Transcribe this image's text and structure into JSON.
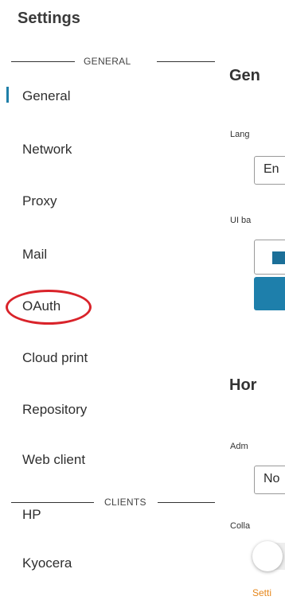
{
  "sidebar": {
    "title": "Settings",
    "section_general": "GENERAL",
    "section_clients": "CLIENTS",
    "items": [
      {
        "label": "General"
      },
      {
        "label": "Network"
      },
      {
        "label": "Proxy"
      },
      {
        "label": "Mail"
      },
      {
        "label": "OAuth"
      },
      {
        "label": "Cloud print"
      },
      {
        "label": "Repository"
      },
      {
        "label": "Web client"
      }
    ],
    "clients": [
      {
        "label": "HP"
      },
      {
        "label": "Kyocera"
      }
    ],
    "active_item": "General"
  },
  "content": {
    "section1_title": "Gen",
    "language_label": "Lang",
    "language_value": "En",
    "ui_label": "UI ba",
    "section2_title": "Hor",
    "admin_label": "Adm",
    "admin_value": "No",
    "collapse_label": "Colla",
    "warning_text": "Setti"
  },
  "colors": {
    "accent": "#1e7fab",
    "highlight_ring": "#d9232a",
    "warning": "#e6861a"
  }
}
